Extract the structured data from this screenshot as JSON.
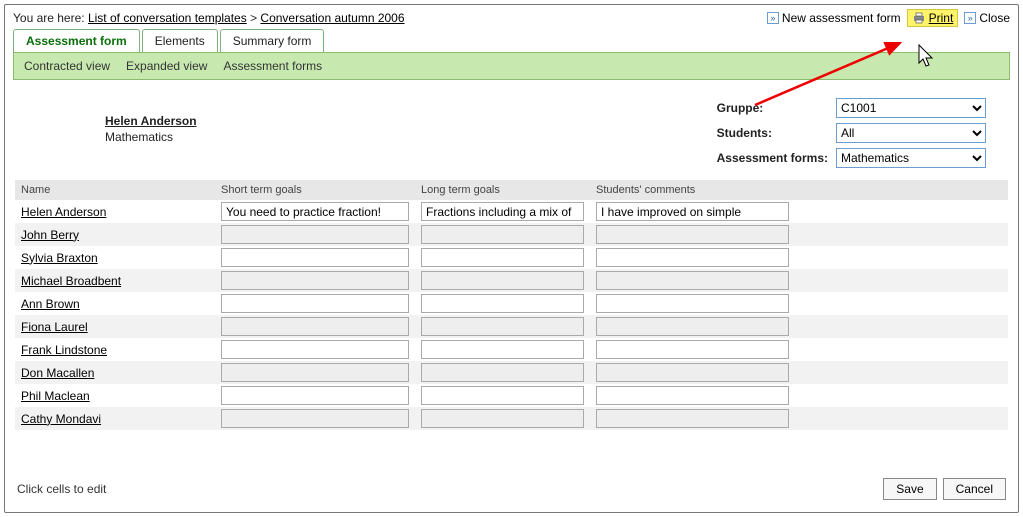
{
  "breadcrumb": {
    "prefix": "You are here:",
    "link1": "List of conversation templates",
    "sep": ">",
    "link2": "Conversation autumn 2006"
  },
  "top_actions": {
    "new_form": "New assessment form",
    "print": "Print",
    "close": "Close"
  },
  "tabs": {
    "t0": "Assessment form",
    "t1": "Elements",
    "t2": "Summary form"
  },
  "subnav": {
    "s0": "Contracted view",
    "s1": "Expanded view",
    "s2": "Assessment forms"
  },
  "student": {
    "name": "Helen Anderson",
    "subject": "Mathematics"
  },
  "filters": {
    "group_label": "Gruppe:",
    "group_value": "C1001",
    "students_label": "Students:",
    "students_value": "All",
    "forms_label": "Assessment forms:",
    "forms_value": "Mathematics"
  },
  "grid": {
    "headers": {
      "name": "Name",
      "short": "Short term goals",
      "long": "Long term goals",
      "comments": "Students' comments"
    },
    "rows": [
      {
        "name": "Helen Anderson",
        "short": "You need to practice fraction!",
        "long": "Fractions including a mix of",
        "comments": "I have improved on simple"
      },
      {
        "name": "John Berry",
        "short": "",
        "long": "",
        "comments": ""
      },
      {
        "name": "Sylvia Braxton",
        "short": "",
        "long": "",
        "comments": ""
      },
      {
        "name": "Michael Broadbent",
        "short": "",
        "long": "",
        "comments": ""
      },
      {
        "name": "Ann Brown",
        "short": "",
        "long": "",
        "comments": ""
      },
      {
        "name": "Fiona Laurel",
        "short": "",
        "long": "",
        "comments": ""
      },
      {
        "name": "Frank Lindstone",
        "short": "",
        "long": "",
        "comments": ""
      },
      {
        "name": "Don Macallen",
        "short": "",
        "long": "",
        "comments": ""
      },
      {
        "name": "Phil Maclean",
        "short": "",
        "long": "",
        "comments": ""
      },
      {
        "name": "Cathy Mondavi",
        "short": "",
        "long": "",
        "comments": ""
      }
    ]
  },
  "footer": {
    "hint": "Click cells to edit",
    "save": "Save",
    "cancel": "Cancel"
  }
}
